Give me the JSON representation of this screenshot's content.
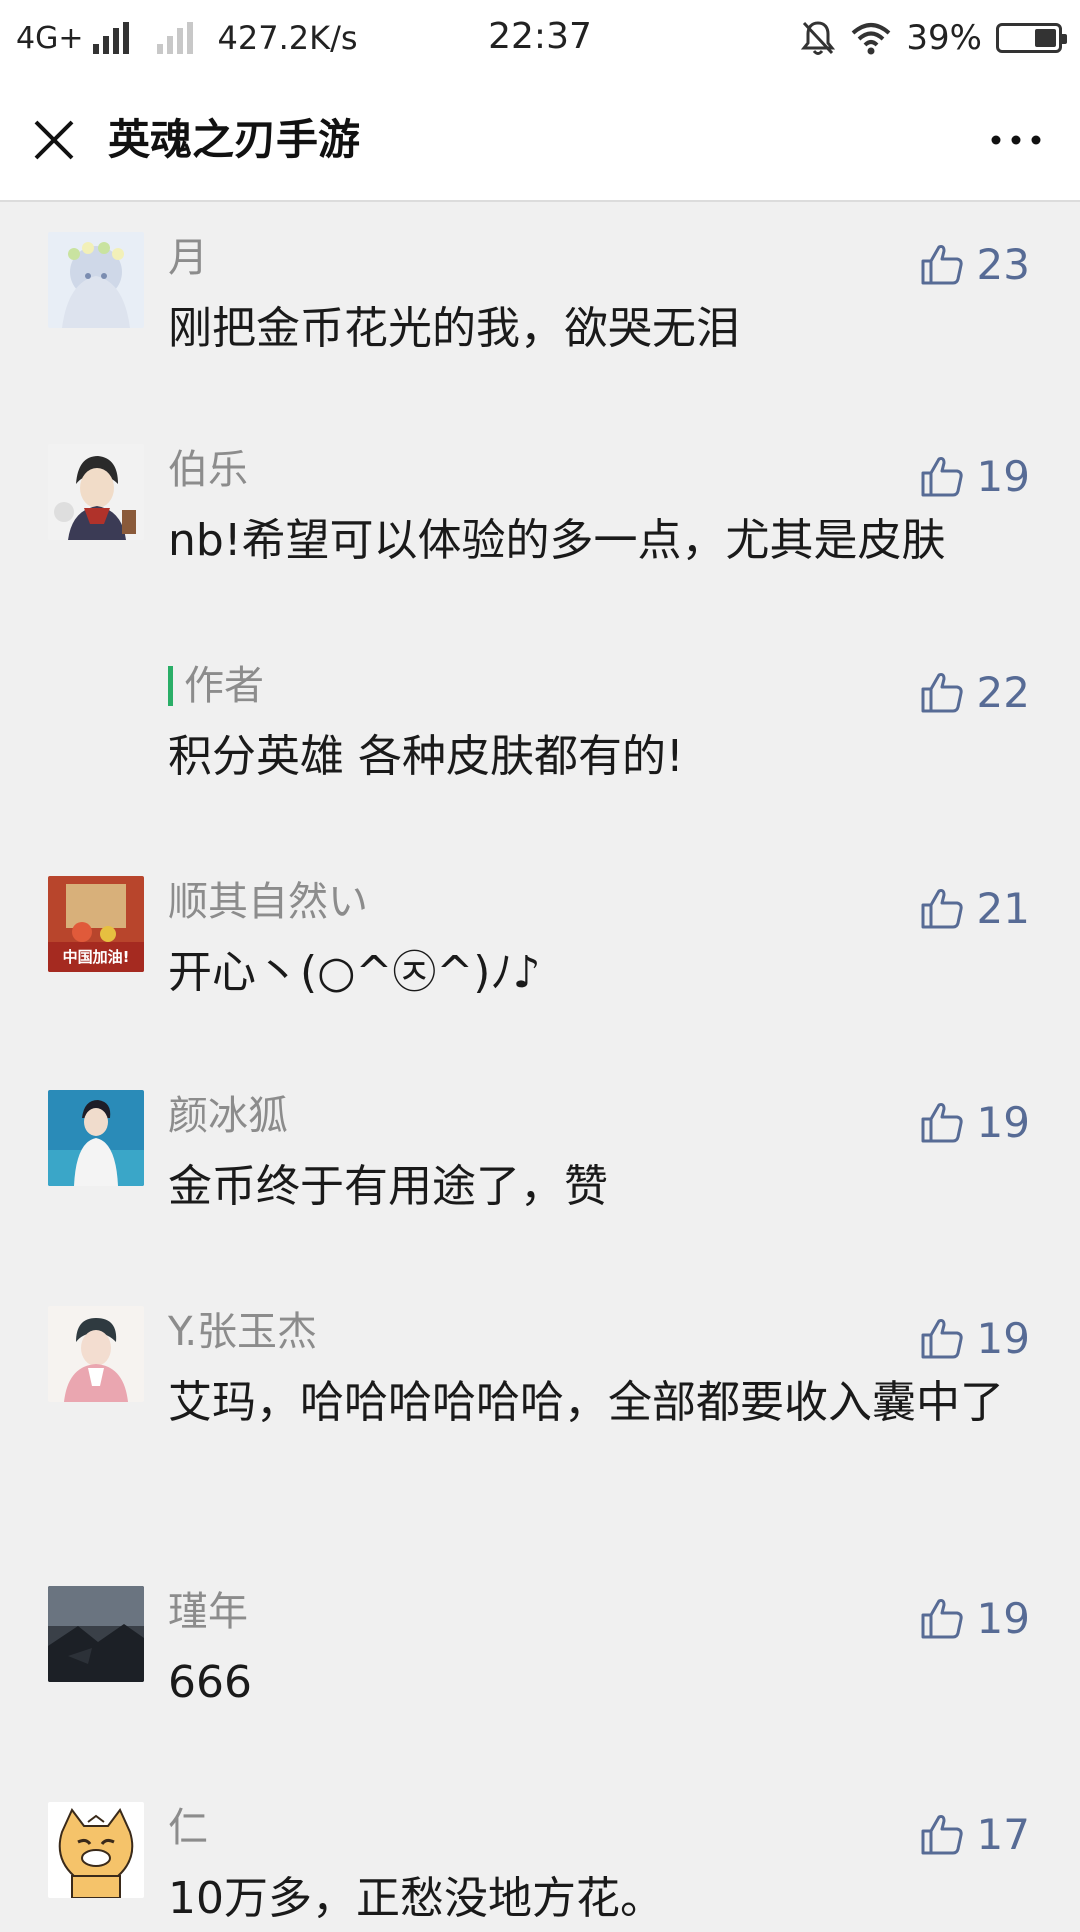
{
  "status_bar": {
    "network": "4G+",
    "speed": "427.2K/s",
    "time": "22:37",
    "battery": "39%",
    "battery_level": 0.39
  },
  "header": {
    "title": "英魂之刃手游"
  },
  "colors": {
    "accent_like": "#576b95",
    "author_bar": "#2aae67",
    "background": "#f0f0f0"
  },
  "comments": [
    {
      "name": "月",
      "text": "刚把金币花光的我，欲哭无泪",
      "likes": "23"
    },
    {
      "name": "伯乐",
      "text": "nb!希望可以体验的多一点，尤其是皮肤",
      "likes": "19",
      "reply": {
        "label": "作者",
        "text": "积分英雄 各种皮肤都有的!",
        "likes": "22"
      }
    },
    {
      "name": "顺其自然い",
      "text": "开心丶(○^㉨^)ﾉ♪",
      "likes": "21",
      "avatar_text": "中国加油!"
    },
    {
      "name": "颜冰狐",
      "text": "金币终于有用途了，赞",
      "likes": "19"
    },
    {
      "name": "Y.张玉杰",
      "text": "艾玛，哈哈哈哈哈哈，全部都要收入囊中了",
      "likes": "19"
    },
    {
      "name": "瑾年",
      "text": "666",
      "likes": "19"
    },
    {
      "name": "仁",
      "text": "10万多，正愁没地方花。",
      "likes": "17"
    }
  ]
}
